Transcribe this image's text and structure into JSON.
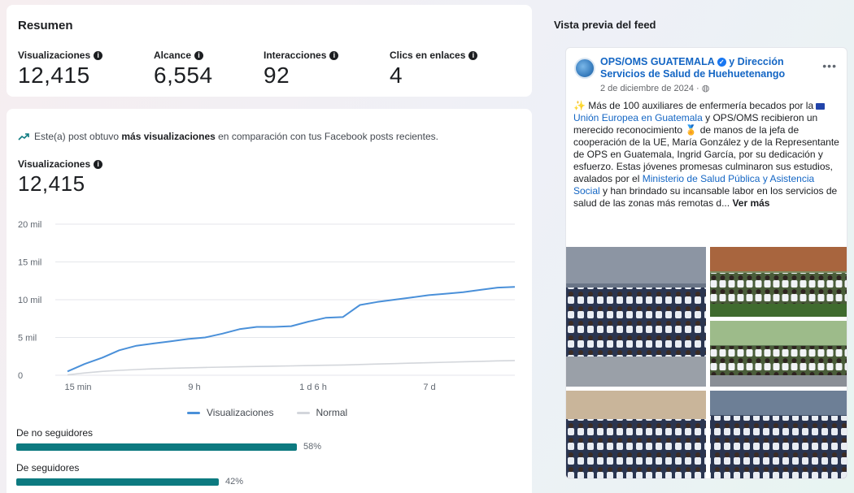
{
  "summary": {
    "title": "Resumen",
    "metrics": [
      {
        "label": "Visualizaciones",
        "value": "12,415"
      },
      {
        "label": "Alcance",
        "value": "6,554"
      },
      {
        "label": "Interacciones",
        "value": "92"
      },
      {
        "label": "Clics en enlaces",
        "value": "4"
      }
    ]
  },
  "insight": {
    "prefix": "Este(a) post obtuvo ",
    "bold": "más visualizaciones",
    "suffix": " en comparación con tus Facebook posts recientes."
  },
  "views": {
    "label": "Visualizaciones",
    "value": "12,415"
  },
  "chart_data": {
    "type": "line",
    "x_ticks": [
      "15 min",
      "9 h",
      "1 d 6 h",
      "7 d"
    ],
    "y_ticks": [
      "0",
      "5 mil",
      "10 mil",
      "15 mil",
      "20 mil"
    ],
    "ylim": [
      0,
      20000
    ],
    "grid": true,
    "legend": "bottom",
    "series": [
      {
        "name": "Visualizaciones",
        "color": "#4a90d9",
        "values": [
          500,
          1500,
          2300,
          3300,
          3900,
          4200,
          4500,
          4800,
          5000,
          5500,
          6100,
          6400,
          6400,
          6500,
          7100,
          7600,
          7700,
          9300,
          9700,
          10000,
          10300,
          10600,
          10800,
          11000,
          11300,
          11600,
          11700
        ]
      },
      {
        "name": "Normal",
        "color": "#d3d6db",
        "values": [
          50,
          300,
          500,
          650,
          750,
          850,
          920,
          980,
          1030,
          1080,
          1120,
          1160,
          1200,
          1240,
          1280,
          1320,
          1360,
          1420,
          1480,
          1540,
          1600,
          1660,
          1720,
          1780,
          1840,
          1900,
          1950
        ]
      }
    ]
  },
  "audience": [
    {
      "label": "De no seguidores",
      "pct": 58,
      "text": "58%"
    },
    {
      "label": "De seguidores",
      "pct": 42,
      "text": "42%"
    }
  ],
  "feed": {
    "title": "Vista previa del feed",
    "author_a": "OPS/OMS GUATEMALA",
    "author_b": " y Dirección Servicios de Salud de Huehuetenango",
    "date": "2 de diciembre de 2024 · ",
    "text_1": " Más de 100 auxiliares de enfermería becados por la ",
    "link_1": "Unión Europea en Guatemala",
    "text_2": "  y OPS/OMS recibieron un merecido reconocimiento ",
    "text_3": " de manos de la jefa de cooperación de la UE, María González y de la Representante de OPS en Guatemala, Ingrid García, por su dedicación y esfuerzo. Estas jóvenes promesas culminaron sus estudios, avalados por el ",
    "link_2": "Ministerio de Salud Pública y Asistencia Social",
    "text_4": " y han brindado su incansable labor en los servicios de salud de las zonas más remotas d... ",
    "see_more": "Ver más"
  }
}
